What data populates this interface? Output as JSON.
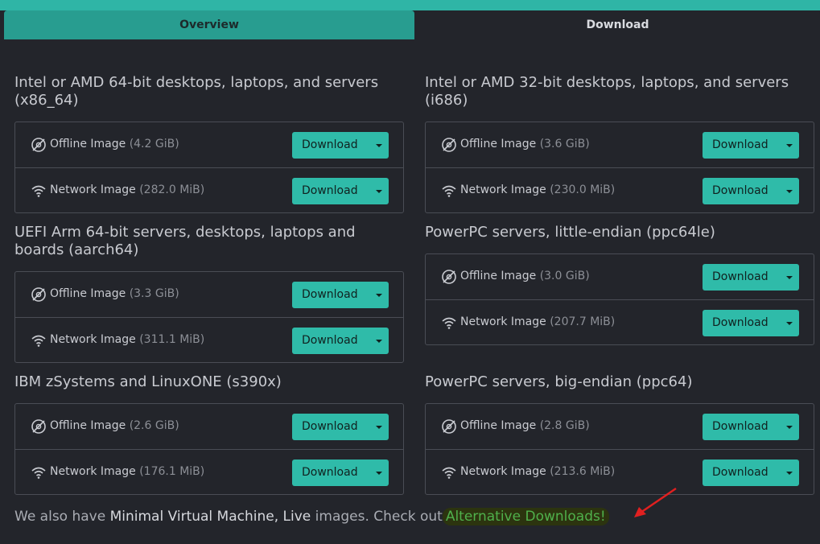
{
  "tabs": {
    "overview": "Overview",
    "download": "Download"
  },
  "sections": [
    {
      "title": "Intel or AMD 64-bit desktops, laptops, and servers (x86_64)",
      "rows": [
        {
          "type": "offline",
          "label": "Offline Image",
          "size": "(4.2 GiB)",
          "button": "Download"
        },
        {
          "type": "network",
          "label": "Network Image",
          "size": "(282.0 MiB)",
          "button": "Download"
        }
      ]
    },
    {
      "title": "Intel or AMD 32-bit desktops, laptops, and servers (i686)",
      "rows": [
        {
          "type": "offline",
          "label": "Offline Image",
          "size": "(3.6 GiB)",
          "button": "Download"
        },
        {
          "type": "network",
          "label": "Network Image",
          "size": "(230.0 MiB)",
          "button": "Download"
        }
      ]
    },
    {
      "title": "UEFI Arm 64-bit servers, desktops, laptops and boards (aarch64)",
      "rows": [
        {
          "type": "offline",
          "label": "Offline Image",
          "size": "(3.3 GiB)",
          "button": "Download"
        },
        {
          "type": "network",
          "label": "Network Image",
          "size": "(311.1 MiB)",
          "button": "Download"
        }
      ]
    },
    {
      "title": "PowerPC servers, little-endian (ppc64le)",
      "rows": [
        {
          "type": "offline",
          "label": "Offline Image",
          "size": "(3.0 GiB)",
          "button": "Download"
        },
        {
          "type": "network",
          "label": "Network Image",
          "size": "(207.7 MiB)",
          "button": "Download"
        }
      ]
    },
    {
      "title": "IBM zSystems and LinuxONE (s390x)",
      "rows": [
        {
          "type": "offline",
          "label": "Offline Image",
          "size": "(2.6 GiB)",
          "button": "Download"
        },
        {
          "type": "network",
          "label": "Network Image",
          "size": "(176.1 MiB)",
          "button": "Download"
        }
      ]
    },
    {
      "title": "PowerPC servers, big-endian (ppc64)",
      "rows": [
        {
          "type": "offline",
          "label": "Offline Image",
          "size": "(2.8 GiB)",
          "button": "Download"
        },
        {
          "type": "network",
          "label": "Network Image",
          "size": "(213.6 MiB)",
          "button": "Download"
        }
      ]
    }
  ],
  "footer": {
    "prefix": "We also have",
    "minimal": "Minimal Virtual Machine,",
    "live": "Live",
    "middle": "images. Check out",
    "link": "Alternative Downloads!"
  },
  "colors": {
    "accent": "#2fbba9",
    "background": "#23252b",
    "link": "#4fb04b",
    "annotation_arrow": "#e02020"
  },
  "icons": {
    "offline": "disc-icon",
    "network": "wifi-icon",
    "dropdown": "caret-down-icon"
  }
}
